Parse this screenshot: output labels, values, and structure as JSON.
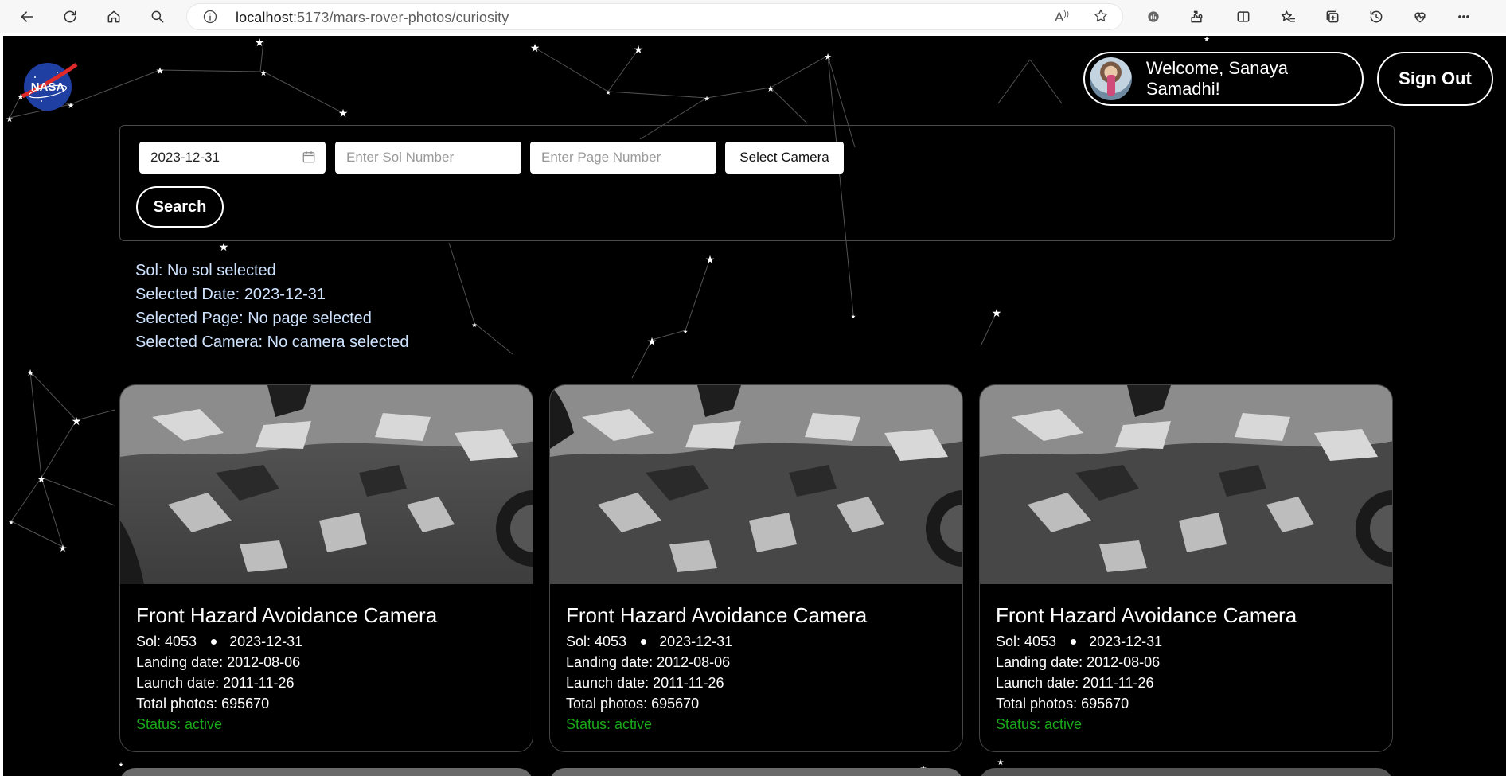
{
  "browser": {
    "url_host": "localhost",
    "url_path": ":5173/mars-rover-photos/curiosity",
    "read_aloud_icon": "read-aloud-icon"
  },
  "header": {
    "welcome_text": "Welcome, Sanaya Samadhi!",
    "signout_label": "Sign Out"
  },
  "search": {
    "date_value": "2023-12-31",
    "sol_placeholder": "Enter Sol Number",
    "page_placeholder": "Enter Page Number",
    "camera_label": "Select Camera",
    "search_label": "Search"
  },
  "selection": {
    "sol": "Sol: No sol selected",
    "date": "Selected Date: 2023-12-31",
    "page": "Selected Page: No page selected",
    "camera": "Selected Camera: No camera selected"
  },
  "cards": [
    {
      "title": "Front Hazard Avoidance Camera",
      "sol": "Sol: 4053",
      "date": "2023-12-31",
      "landing": "Landing date: 2012-08-06",
      "launch": "Launch date: 2011-11-26",
      "photos": "Total photos: 695670",
      "status": "Status: active"
    },
    {
      "title": "Front Hazard Avoidance Camera",
      "sol": "Sol: 4053",
      "date": "2023-12-31",
      "landing": "Landing date: 2012-08-06",
      "launch": "Launch date: 2011-11-26",
      "photos": "Total photos: 695670",
      "status": "Status: active"
    },
    {
      "title": "Front Hazard Avoidance Camera",
      "sol": "Sol: 4053",
      "date": "2023-12-31",
      "landing": "Landing date: 2012-08-06",
      "launch": "Launch date: 2011-11-26",
      "photos": "Total photos: 695670",
      "status": "Status: active"
    }
  ],
  "colors": {
    "status_active": "#1aa81a",
    "info_text": "#cfe3ff",
    "page_bg": "#000000"
  }
}
